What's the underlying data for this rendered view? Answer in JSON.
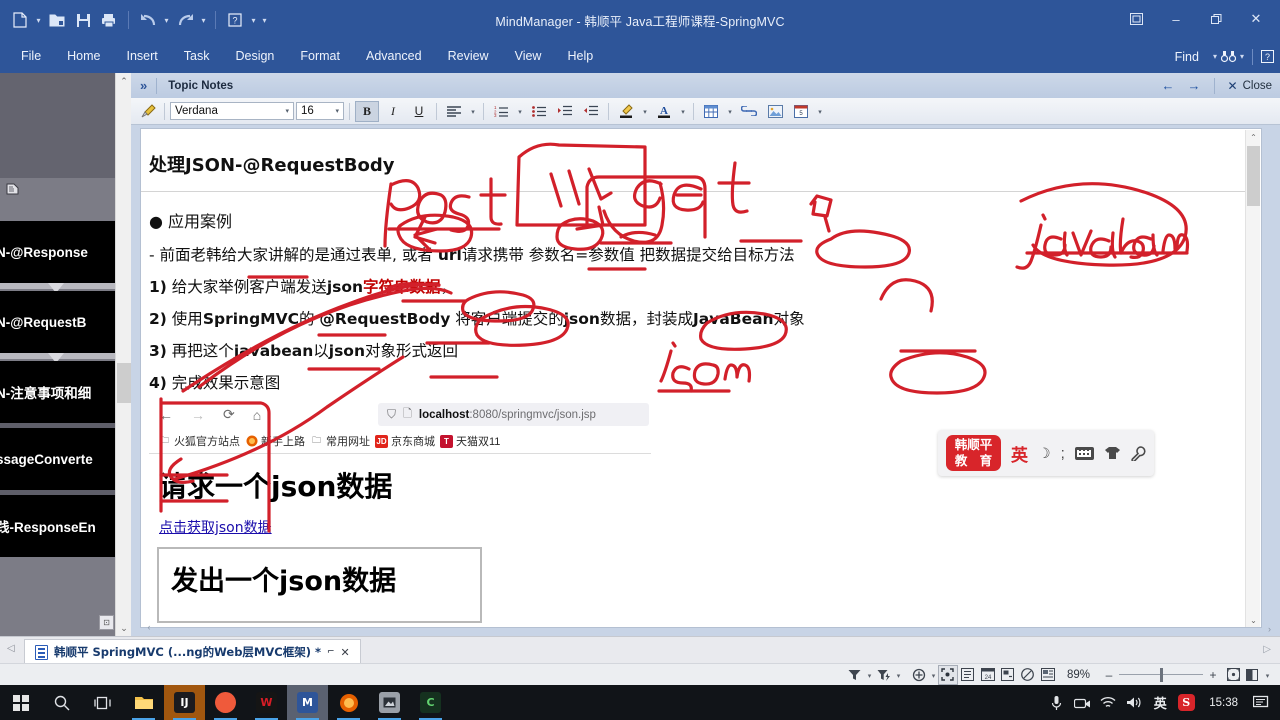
{
  "window": {
    "title": "MindManager - 韩顺平 Java工程师课程-SpringMVC",
    "quick_access": [
      {
        "name": "new-document",
        "glyph": "🗋"
      },
      {
        "name": "open-document",
        "glyph": "🗁"
      },
      {
        "name": "save-document",
        "glyph": "🖫"
      },
      {
        "name": "print-document",
        "glyph": "🖶"
      },
      {
        "name": "undo",
        "glyph": "↶"
      },
      {
        "name": "redo",
        "glyph": "↷"
      },
      {
        "name": "help-dropdown",
        "glyph": "?"
      }
    ],
    "controls": {
      "ribbon_display": "⊞",
      "minimize": "‒",
      "restore": "🗗",
      "close": "✕"
    }
  },
  "ribbon": {
    "tabs": [
      "File",
      "Home",
      "Insert",
      "Task",
      "Design",
      "Format",
      "Advanced",
      "Review",
      "View",
      "Help"
    ],
    "find_label": "Find",
    "find_icon": "🔎",
    "help_icon": "?"
  },
  "notes_panel": {
    "expand_icon": "»",
    "title": "Topic Notes",
    "back_icon": "←",
    "forward_icon": "→",
    "close_label": "Close",
    "close_icon": "✕"
  },
  "format_toolbar": {
    "format_painter_icon": "🖌",
    "font_name": "Verdana",
    "font_size": "16",
    "bold": "B",
    "italic": "I",
    "underline": "U",
    "align": "≡",
    "numbered_list": "⒈",
    "bulleted_list": "☰",
    "decrease_indent": "⇤",
    "increase_indent": "⇥",
    "highlight": "🖍",
    "font_color": "A",
    "table": "▦",
    "link": "🔗",
    "image": "🖼",
    "datestamp": "📅"
  },
  "map_pane": {
    "nodes": [
      {
        "label": "N-@Response"
      },
      {
        "label": "N-@RequestB"
      },
      {
        "label": "N-注意事项和细"
      },
      {
        "label": "ssageConverte"
      },
      {
        "label": "践-ResponseEn"
      }
    ],
    "scroll_up": "⌃",
    "scroll_down": "⌄",
    "corner_icon": "⊡",
    "topic_icon": "🗏"
  },
  "notes_content": {
    "doc_title": "处理JSON-@RequestBody",
    "bullet": "● 应用案例",
    "line_dash": {
      "prefix": "- 前面老韩给大家讲解的是通过表单, 或者 ",
      "url": "url",
      "rest": "请求携带 参数名=参数值 把数据提交给目标方法"
    },
    "item1": {
      "num": "1)",
      "t1": " 给大家举例客户端发送",
      "b1": "json",
      "r1": "字符串数据",
      "t2": "，"
    },
    "item2": {
      "num": "2)",
      "t1": " 使用",
      "b1": "SpringMVC",
      "t2": "的 ",
      "b2": "@RequestBody",
      "t3": " 将客户端提交的",
      "b3": "json",
      "t4": "数据，封装成",
      "b4": "JavaBean",
      "t5": "对象"
    },
    "item3": {
      "num": "3)",
      "t1": " 再把这个",
      "b1": "javabean",
      "t2": "以",
      "b2": "json",
      "t3": "对象形式返回"
    },
    "item4": {
      "num": "4)",
      "t1": " 完成效果示意图"
    }
  },
  "browser_shot": {
    "back_icon": "←",
    "forward_icon": "→",
    "reload_icon": "⟳",
    "home_icon": "⌂",
    "shield_icon": "⛉",
    "page_icon": "🗋",
    "url_host": "localhost",
    "url_path": ":8080/springmvc/json.jsp",
    "bookmarks": [
      {
        "label": "火狐官方站点",
        "icon": "folder",
        "color": "#6f7782",
        "text": ""
      },
      {
        "label": "新手上路",
        "icon": "firefox",
        "color": "#e66000",
        "text": ""
      },
      {
        "label": "常用网址",
        "icon": "folder",
        "color": "#6f7782",
        "text": ""
      },
      {
        "label": "京东商城",
        "icon": "square",
        "color": "#e1251b",
        "text": "JD"
      },
      {
        "label": "天猫双11",
        "icon": "square",
        "color": "#c4122e",
        "text": "T"
      }
    ],
    "heading": "请求一个json数据",
    "link": "点击获取json数据",
    "box_text": "发出一个json数据"
  },
  "ime_bar": {
    "logo_line1": "韩顺平",
    "logo_line2": "教 育",
    "mode": "英",
    "moon_icon": "☽",
    "semicolon": ";",
    "keyboard_icon": "keyboard",
    "skin_icon": "👕",
    "tools_icon": "🔧"
  },
  "doc_tab": {
    "label": "韩顺平 SpringMVC (...ng的Web层MVC框架) *",
    "restore_icon": "⌐",
    "close_icon": "✕",
    "left_arrow": "◁",
    "right_arrow": "▷"
  },
  "statusbar": {
    "filter_icon": "▼",
    "filter_power_icon": "▼",
    "focus_icon": "⊕",
    "fit_icon": "⛶",
    "outline_icon": "▤",
    "calendar_icon": "24",
    "branch_icon": "🗂",
    "eraser_icon": "⊘",
    "presentation_icon": "🖵",
    "zoom_level": "89%",
    "zoom_out": "–",
    "zoom_in": "+",
    "fit_page_icon": "⛶",
    "view_split_icon": "◧"
  },
  "taskbar": {
    "start_icon": "windows-logo",
    "search_icon": "🔍",
    "taskview_icon": "🗗",
    "apps": [
      {
        "name": "file-explorer",
        "label": "🗀",
        "color": "#f3c14b",
        "text_color": "#6b4e00",
        "state": "open"
      },
      {
        "name": "intellij-idea",
        "label": "IJ",
        "color": "#2b2b2b",
        "text_color": "#ffffff",
        "state": "active-highlight"
      },
      {
        "name": "browser-orange",
        "label": "",
        "color": "#ef5a3b",
        "text_color": "#ffffff",
        "state": "open"
      },
      {
        "name": "wps-writer",
        "label": "W",
        "color": "#1a1a1a",
        "text_color": "#d81c26",
        "state": "open"
      },
      {
        "name": "mindmanager",
        "label": "M",
        "color": "#2e5599",
        "text_color": "#ffffff",
        "state": "active"
      },
      {
        "name": "firefox",
        "label": "",
        "color": "#e66000",
        "text_color": "#ffffff",
        "state": "open"
      },
      {
        "name": "screenshot-tool",
        "label": "🖼",
        "color": "#8a8f98",
        "text_color": "#ffffff",
        "state": "open"
      },
      {
        "name": "typora",
        "label": "C",
        "color": "#1e3a2b",
        "text_color": "#63d471",
        "state": "open"
      }
    ],
    "tray": [
      {
        "name": "microphone-icon",
        "glyph": "🎤"
      },
      {
        "name": "camera-icon",
        "glyph": "📷"
      },
      {
        "name": "wifi-icon",
        "glyph": "📶"
      },
      {
        "name": "volume-icon",
        "glyph": "🔊"
      },
      {
        "name": "ime-language-icon",
        "glyph": "英"
      },
      {
        "name": "sogou-icon",
        "glyph": "S"
      }
    ],
    "clock": "15:38",
    "notification_icon": "🗨"
  }
}
